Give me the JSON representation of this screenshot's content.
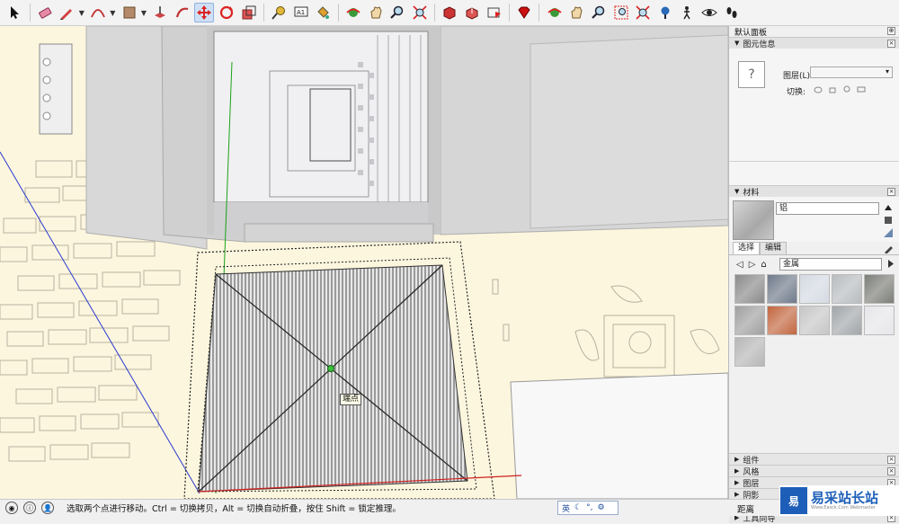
{
  "toolbar": {
    "icons": [
      "select-arrow",
      "eraser",
      "pencil-line",
      "arc",
      "rectangle",
      "push-pull",
      "follow-me",
      "move",
      "rotate",
      "scale",
      "tape-measure",
      "text",
      "paint-bucket",
      "orbit",
      "pan",
      "zoom",
      "zoom-extents",
      "component-make",
      "component-outer",
      "scenes",
      "ruby",
      "section-plane",
      "walk",
      "zoom-window",
      "zoom-previous",
      "zoom-fit",
      "position-camera",
      "look-around",
      "footprint"
    ]
  },
  "viewport": {
    "tooltip": "端点"
  },
  "panel": {
    "title": "默认面板",
    "entity_info": {
      "header": "图元信息",
      "layer_label": "图层(L):",
      "toggle_label": "切换:"
    },
    "materials": {
      "header": "材料",
      "material_name": "铝",
      "tabs": [
        "选择",
        "编辑"
      ],
      "collection": "金属",
      "swatch_colors": [
        "#8a8a8a",
        "#6f7a8a",
        "#d4dae2",
        "#b8bcbf",
        "#7c7e78",
        "#a0a0a0",
        "#c2663f",
        "#c6c6c6",
        "#a2a6a9",
        "#e6e6ea",
        "#b6b6b6"
      ]
    },
    "collapsed": [
      {
        "label": "组件"
      },
      {
        "label": "风格"
      },
      {
        "label": "图层"
      },
      {
        "label": "阴影"
      },
      {
        "label": "场景"
      },
      {
        "label": "工具向导"
      }
    ]
  },
  "status": {
    "text": "选取两个点进行移动。Ctrl = 切换拷贝，Alt = 切换自动折叠，按住 Shift = 锁定推理。",
    "ime": "英",
    "measure_label": "距离"
  },
  "watermark": {
    "logo": "易",
    "text": "易采站长站",
    "url": "Www.Easck.Com Webmaster"
  },
  "colors": {
    "viewport_bg": "#fcf6de",
    "wall": "#d9d9d9",
    "blue_axis": "#2a3ad0",
    "red_axis": "#d22020",
    "green_axis": "#1aa21a"
  }
}
